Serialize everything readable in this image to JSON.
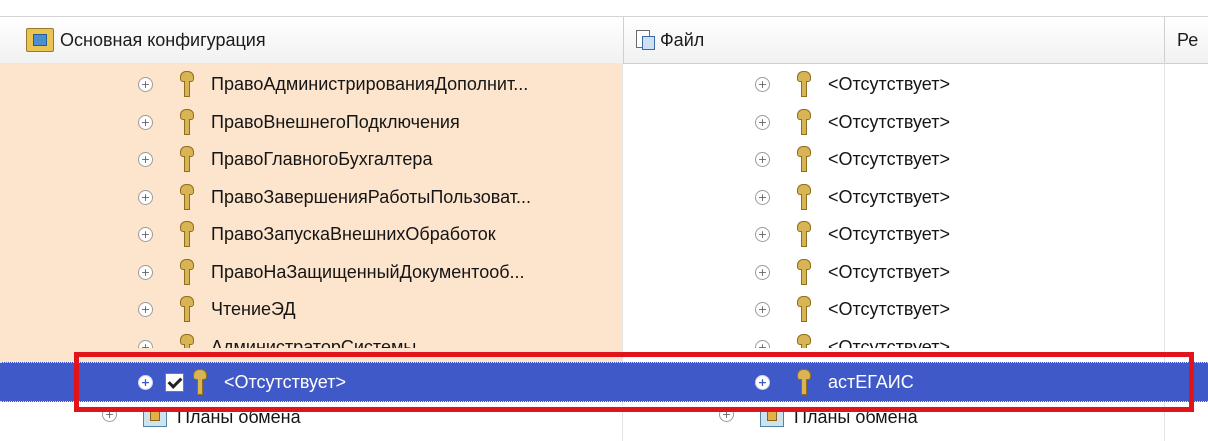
{
  "header": {
    "col1": "Основная конфигурация",
    "col2": "Файл",
    "col3": "Ре"
  },
  "rows": [
    {
      "left": "ПравоАдминистрированияДополнит...",
      "right": "<Отсутствует>"
    },
    {
      "left": "ПравоВнешнегоПодключения",
      "right": "<Отсутствует>"
    },
    {
      "left": "ПравоГлавногоБухгалтера",
      "right": "<Отсутствует>"
    },
    {
      "left": "ПравоЗавершенияРаботыПользоват...",
      "right": "<Отсутствует>"
    },
    {
      "left": "ПравоЗапускаВнешнихОбработок",
      "right": "<Отсутствует>"
    },
    {
      "left": "ПравоНаЗащищенныйДокументооб...",
      "right": "<Отсутствует>"
    },
    {
      "left": "ЧтениеЭД",
      "right": "<Отсутствует>"
    },
    {
      "left": "АдминистраторСистемы",
      "right": "<Отсутствует>"
    }
  ],
  "selected": {
    "left": "<Отсутствует>",
    "right": "астЕГАИС",
    "checked": true
  },
  "bottom": {
    "left": "Планы обмена",
    "right": "Планы обмена"
  },
  "colors": {
    "selection": "#4059c9",
    "left_column": "#fde4cc",
    "highlight_box": "#e1141c"
  }
}
